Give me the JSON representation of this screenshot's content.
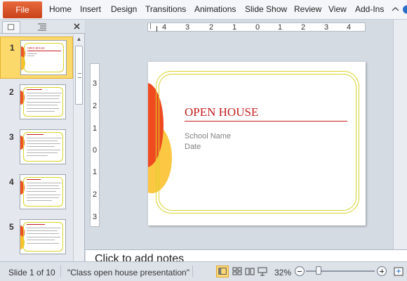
{
  "ribbon": {
    "file_label": "File",
    "tabs": [
      "Home",
      "Insert",
      "Design",
      "Transitions",
      "Animations",
      "Slide Show",
      "Review",
      "View",
      "Add-Ins"
    ]
  },
  "thumbnails": [
    {
      "number": "1",
      "title": "OPEN HOUSE"
    },
    {
      "number": "2",
      "title": ""
    },
    {
      "number": "3",
      "title": ""
    },
    {
      "number": "4",
      "title": ""
    },
    {
      "number": "5",
      "title": ""
    }
  ],
  "ruler": {
    "h_labels": [
      "4",
      "3",
      "2",
      "1",
      "0",
      "1",
      "2",
      "3",
      "4"
    ],
    "v_labels": [
      "3",
      "2",
      "1",
      "0",
      "1",
      "2",
      "3"
    ]
  },
  "slide": {
    "title": "OPEN HOUSE",
    "subtitle_lines": [
      "School Name",
      "Date"
    ]
  },
  "notes": {
    "placeholder": "Click to add notes"
  },
  "status": {
    "slide_indicator": "Slide 1 of 10",
    "theme": "\"Class open house presentation\"",
    "zoom": "32%"
  }
}
